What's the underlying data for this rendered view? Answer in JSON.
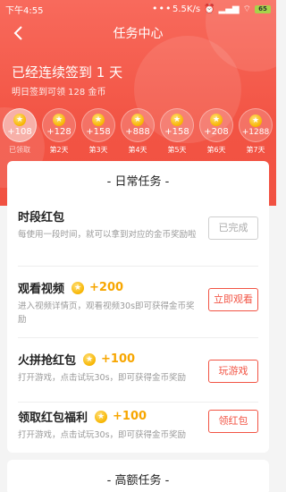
{
  "status_bar": {
    "time": "下午4:55",
    "dots": "•••",
    "speed": "5.5K/s",
    "battery": "65"
  },
  "nav": {
    "title": "任务中心"
  },
  "signin": {
    "title": "已经连续签到 1 天",
    "subtitle": "明日签到可领 128 金币"
  },
  "days": [
    {
      "amount": "+108",
      "label": "已领取",
      "claimed": true
    },
    {
      "amount": "+128",
      "label": "第2天"
    },
    {
      "amount": "+158",
      "label": "第3天"
    },
    {
      "amount": "+888",
      "label": "第4天"
    },
    {
      "amount": "+158",
      "label": "第5天"
    },
    {
      "amount": "+208",
      "label": "第6天"
    },
    {
      "amount": "+1288",
      "label": "第7天"
    }
  ],
  "daily": {
    "title": "- 日常任务 -",
    "tasks": [
      {
        "name": "时段红包",
        "reward": "",
        "desc": "每使用一段时间，就可以拿到对应的金币奖励啦",
        "button": "已完成"
      },
      {
        "name": "观看视频",
        "reward": "+200",
        "desc": "进入视频详情页，观看视频30s即可获得金币奖励",
        "button": "立即观看"
      },
      {
        "name": "火拼抢红包",
        "reward": "+100",
        "desc": "打开游戏，点击试玩30s，即可获得金币奖励",
        "button": "玩游戏"
      },
      {
        "name": "领取红包福利",
        "reward": "+100",
        "desc": "打开游戏，点击试玩30s，即可获得金币奖励",
        "button": "领红包"
      }
    ]
  },
  "high": {
    "title": "- 高额任务 -"
  },
  "colors": {
    "primary": "#f25444",
    "coin": "#f7b500",
    "reward_text": "#f7a600"
  },
  "icons": {
    "back": "back-arrow-icon",
    "coin": "coin-icon",
    "star": "★"
  }
}
